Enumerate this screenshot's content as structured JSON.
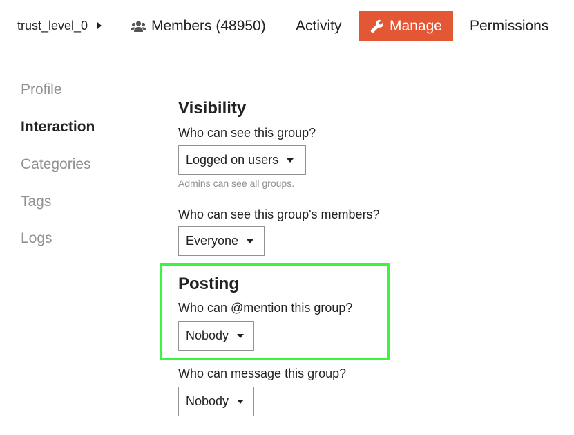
{
  "header": {
    "group_name": "trust_level_0",
    "members_label": "Members (48950)",
    "activity_label": "Activity",
    "manage_label": "Manage",
    "permissions_label": "Permissions",
    "accent_color": "#e45735"
  },
  "sidebar": {
    "items": [
      {
        "label": "Profile",
        "active": false
      },
      {
        "label": "Interaction",
        "active": true
      },
      {
        "label": "Categories",
        "active": false
      },
      {
        "label": "Tags",
        "active": false
      },
      {
        "label": "Logs",
        "active": false
      }
    ]
  },
  "visibility": {
    "title": "Visibility",
    "see_group_label": "Who can see this group?",
    "see_group_value": "Logged on users",
    "see_group_help": "Admins can see all groups.",
    "see_members_label": "Who can see this group's members?",
    "see_members_value": "Everyone"
  },
  "posting": {
    "title": "Posting",
    "mention_label": "Who can @mention this group?",
    "mention_value": "Nobody",
    "message_label": "Who can message this group?",
    "message_value": "Nobody"
  },
  "highlight_color": "#3cf53c",
  "icons": [
    "caret-right-icon",
    "users-icon",
    "wrench-icon",
    "caret-down-icon"
  ]
}
